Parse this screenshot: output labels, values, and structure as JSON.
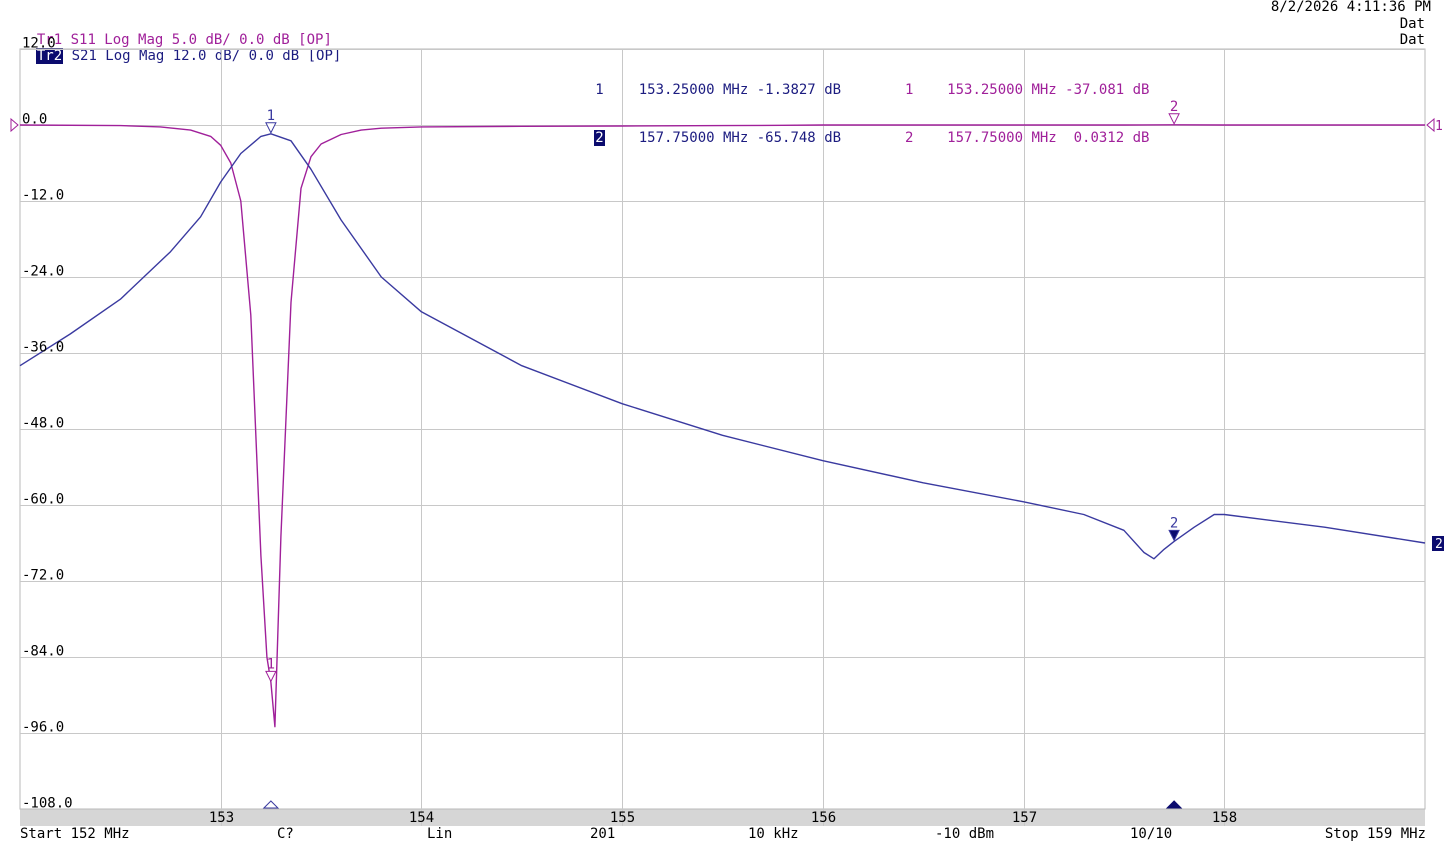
{
  "header": {
    "datetime": "8/2/2026 4:11:36 PM",
    "trace1": {
      "id": "Tr1",
      "desc": "S11 Log Mag 5.0 dB/ 0.0 dB [OP]",
      "status": "Dat"
    },
    "trace2": {
      "id": "Tr2",
      "desc": "S21 Log Mag 12.0 dB/ 0.0 dB [OP]",
      "status": "Dat"
    }
  },
  "markers_trace2": [
    {
      "num": "1",
      "freq": "153.25000 MHz",
      "value": "-1.3827",
      "unit": "dB"
    },
    {
      "num": "2",
      "freq": "157.75000 MHz",
      "value": "-65.748",
      "unit": "dB"
    }
  ],
  "markers_trace1": [
    {
      "num": "1",
      "freq": "153.25000 MHz",
      "value": "-37.081",
      "unit": "dB"
    },
    {
      "num": "2",
      "freq": "157.75000 MHz",
      "value": "0.0312",
      "unit": "dB"
    }
  ],
  "footer": {
    "start": "Start 152 MHz",
    "cal": "C?",
    "sweep": "Lin",
    "points": "201",
    "ifbw": "10 kHz",
    "power": "-10 dBm",
    "avg": "10/10",
    "stop": "Stop 159 MHz"
  },
  "colors": {
    "trace1": "#a0209a",
    "trace2": "#3a3aa0",
    "grid": "#c8c8c8",
    "bottom_bar": "#d6d6d6",
    "marker_fill": "#0b0b6e"
  },
  "chart_data": {
    "type": "line",
    "xlim": [
      152,
      159
    ],
    "ylim": [
      -108,
      12
    ],
    "x_ticks": [
      153,
      154,
      155,
      156,
      157,
      158
    ],
    "y_ticks": [
      "12.0",
      "0.0",
      "-12.0",
      "-24.0",
      "-36.0",
      "-48.0",
      "-60.0",
      "-72.0",
      "-84.0",
      "-96.0",
      "-108.0"
    ],
    "x_tick_labels": [
      "153",
      "154",
      "155",
      "156",
      "157",
      "158"
    ],
    "reference_level": 0,
    "series": [
      {
        "name": "S11",
        "x": [
          152.0,
          152.5,
          152.7,
          152.85,
          152.95,
          153.0,
          153.05,
          153.1,
          153.15,
          153.2,
          153.23,
          153.25,
          153.27,
          153.3,
          153.35,
          153.4,
          153.45,
          153.5,
          153.6,
          153.7,
          153.8,
          154.0,
          154.5,
          155.0,
          155.5,
          155.8,
          156.0,
          156.5,
          157.0,
          157.5,
          157.75,
          158.0,
          158.5,
          159.0
        ],
        "y": [
          0.0,
          -0.1,
          -0.3,
          -0.8,
          -1.8,
          -3.2,
          -6.0,
          -12.0,
          -30.0,
          -68.0,
          -84.0,
          -88.0,
          -95.0,
          -65.0,
          -28.0,
          -10.0,
          -5.0,
          -3.0,
          -1.5,
          -0.8,
          -0.5,
          -0.3,
          -0.2,
          -0.15,
          -0.1,
          -0.05,
          0.0,
          0.0,
          0.0,
          0.0,
          0.0312,
          0.0,
          0.0,
          0.0
        ]
      },
      {
        "name": "S21",
        "x": [
          152.0,
          152.25,
          152.5,
          152.75,
          152.9,
          153.0,
          153.1,
          153.2,
          153.25,
          153.35,
          153.45,
          153.6,
          153.8,
          154.0,
          154.5,
          155.0,
          155.5,
          156.0,
          156.5,
          157.0,
          157.3,
          157.5,
          157.6,
          157.65,
          157.7,
          157.75,
          157.85,
          157.95,
          158.0,
          158.5,
          159.0
        ],
        "y": [
          -38.0,
          -33.0,
          -27.5,
          -20.0,
          -14.5,
          -9.0,
          -4.5,
          -1.8,
          -1.3827,
          -2.5,
          -7.0,
          -15.0,
          -24.0,
          -29.5,
          -38.0,
          -44.0,
          -49.0,
          -53.0,
          -56.5,
          -59.5,
          -61.5,
          -64.0,
          -67.5,
          -68.5,
          -67.0,
          -65.748,
          -63.5,
          -61.5,
          -61.5,
          -63.5,
          -66.0
        ]
      }
    ],
    "markers": [
      {
        "trace": "S21",
        "num": "1",
        "x": 153.25,
        "y": -1.3827
      },
      {
        "trace": "S21",
        "num": "2",
        "x": 157.75,
        "y": -65.748
      },
      {
        "trace": "S11",
        "num": "1",
        "x": 153.25,
        "y": -88.0
      },
      {
        "trace": "S11",
        "num": "2",
        "x": 157.75,
        "y": 0.0312
      }
    ]
  }
}
